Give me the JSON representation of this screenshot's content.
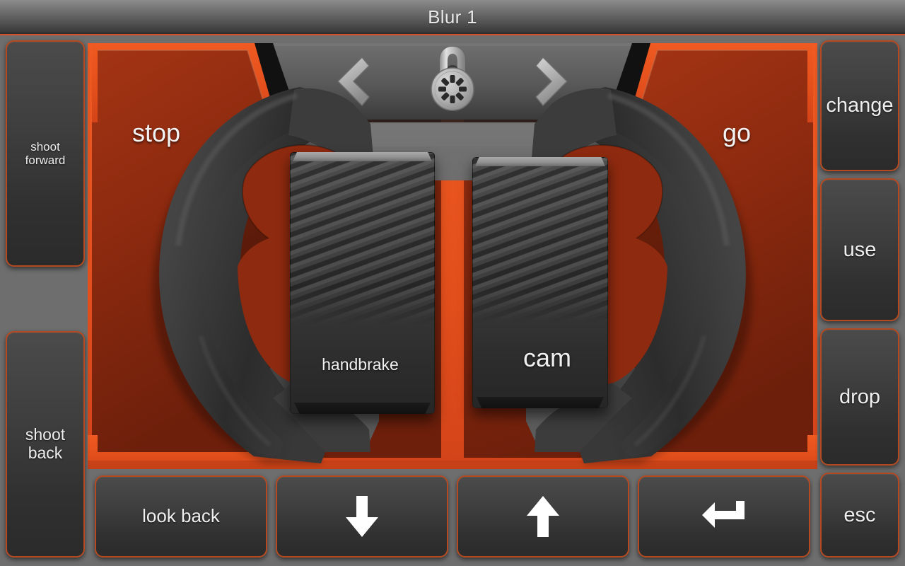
{
  "window": {
    "title": "Blur 1"
  },
  "colors": {
    "accent_orange": "#e4501c",
    "dark_orange": "#8e2a0f",
    "button_border": "#b34a22",
    "background_gray": "#6e6e6e",
    "panel_gray": "#6b6b6b",
    "text": "#efefef"
  },
  "left_controls": [
    {
      "id": "shoot-forward",
      "label": "shoot\nforward",
      "line1": "shoot",
      "line2": "forward"
    },
    {
      "id": "shoot-back",
      "label": "shoot\nback",
      "line1": "shoot",
      "line2": "back"
    }
  ],
  "right_controls": [
    {
      "id": "change",
      "label": "change"
    },
    {
      "id": "use",
      "label": "use"
    },
    {
      "id": "drop",
      "label": "drop"
    },
    {
      "id": "esc",
      "label": "esc"
    }
  ],
  "bottom_controls": [
    {
      "id": "look-back",
      "label": "look back",
      "icon": null
    },
    {
      "id": "down",
      "label": "",
      "icon": "arrow-down-icon"
    },
    {
      "id": "up",
      "label": "",
      "icon": "arrow-up-icon"
    },
    {
      "id": "enter",
      "label": "",
      "icon": "enter-return-icon"
    }
  ],
  "top_center_controls": [
    {
      "id": "previous",
      "icon": "chevron-left-icon"
    },
    {
      "id": "lock",
      "icon": "padlock-icon"
    },
    {
      "id": "next",
      "icon": "chevron-right-icon"
    }
  ],
  "steering": {
    "left_label": "stop",
    "right_label": "go"
  },
  "pedals": [
    {
      "id": "handbrake",
      "label": "handbrake"
    },
    {
      "id": "cam",
      "label": "cam"
    }
  ]
}
